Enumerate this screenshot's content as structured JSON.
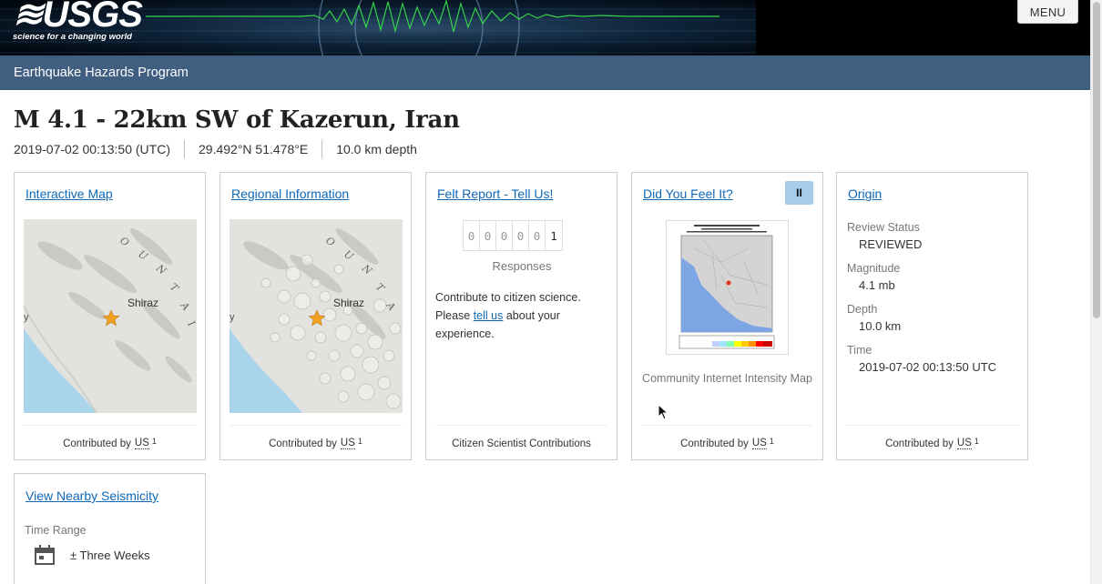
{
  "header": {
    "logo_text": "≋USGS",
    "logo_tagline": "science for a changing world",
    "menu_label": "MENU"
  },
  "subheader": {
    "program": "Earthquake Hazards Program"
  },
  "event": {
    "title": "M 4.1 - 22km SW of Kazerun, Iran",
    "time": "2019-07-02 00:13:50 (UTC)",
    "location": "29.492°N 51.478°E",
    "depth": "10.0 km depth"
  },
  "cards": {
    "interactive_map": {
      "link": "Interactive Map",
      "city": "Shiraz",
      "footer_prefix": "Contributed by",
      "footer_source": "US",
      "footer_note": "1"
    },
    "regional_info": {
      "link": "Regional Information",
      "city": "Shiraz",
      "footer_prefix": "Contributed by",
      "footer_source": "US",
      "footer_note": "1"
    },
    "felt_report": {
      "link": "Felt Report - Tell Us!",
      "counter_digits": [
        "0",
        "0",
        "0",
        "0",
        "0",
        "1"
      ],
      "responses_label": "Responses",
      "text_before": "Contribute to citizen science. Please ",
      "tell_us_link": "tell us",
      "text_after": " about your experience.",
      "footer": "Citizen Scientist Contributions"
    },
    "dyfi": {
      "link": "Did You Feel It?",
      "pause_label": "II",
      "caption": "Community Internet Intensity Map",
      "footer_prefix": "Contributed by",
      "footer_source": "US",
      "footer_note": "1"
    },
    "origin": {
      "link": "Origin",
      "review_status_label": "Review Status",
      "review_status": "REVIEWED",
      "magnitude_label": "Magnitude",
      "magnitude": "4.1 mb",
      "depth_label": "Depth",
      "depth": "10.0 km",
      "time_label": "Time",
      "time": "2019-07-02 00:13:50 UTC",
      "footer_prefix": "Contributed by",
      "footer_source": "US",
      "footer_note": "1"
    },
    "seismicity": {
      "link": "View Nearby Seismicity",
      "time_range_label": "Time Range",
      "time_range": "± Three Weeks"
    }
  },
  "colors": {
    "header_bg": "#000000",
    "subheader_bg": "#3f5e80",
    "link": "#0e68b8",
    "epicenter_star": "#f0a020",
    "pause_bg": "#a6cce9"
  }
}
